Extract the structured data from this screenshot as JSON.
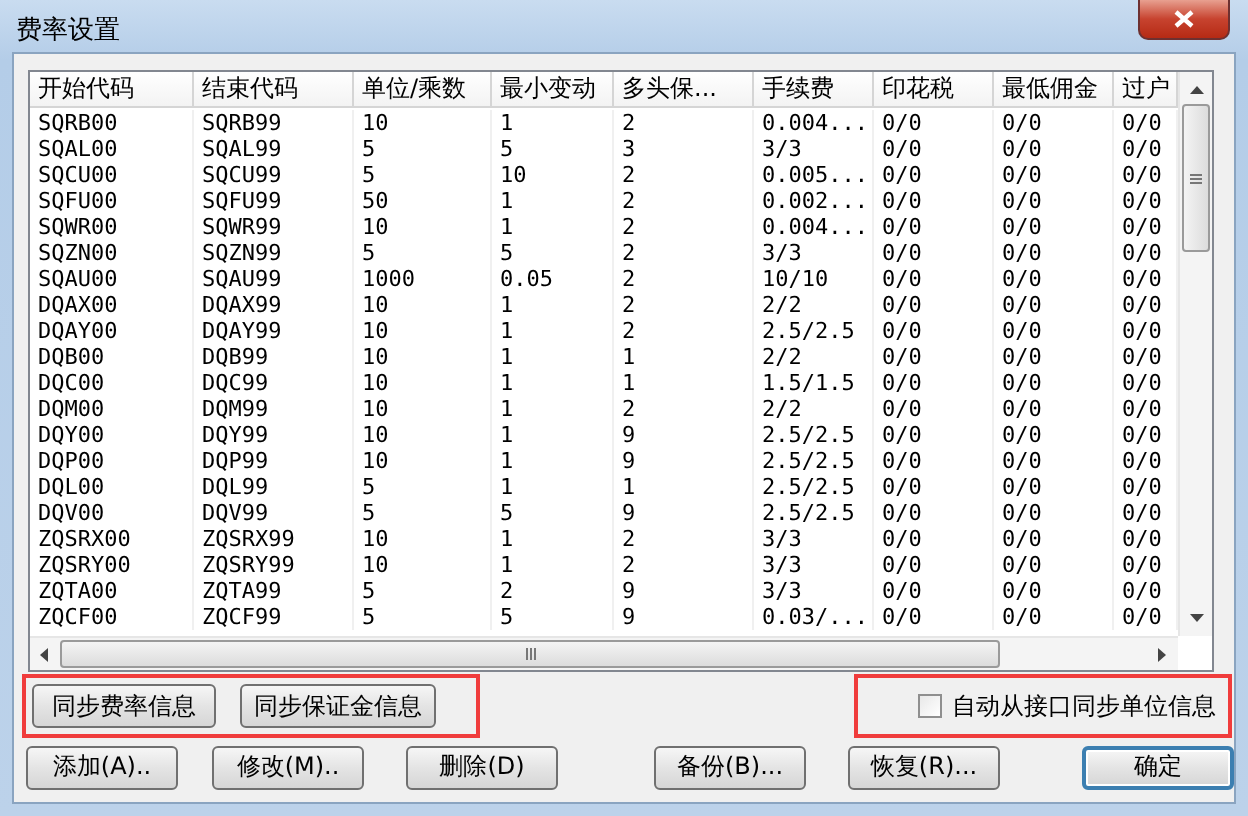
{
  "window": {
    "title": "费率设置"
  },
  "table": {
    "columns": [
      "开始代码",
      "结束代码",
      "单位/乘数",
      "最小变动",
      "多头保...",
      "手续费",
      "印花税",
      "最低佣金",
      "过户"
    ],
    "rows": [
      [
        "SQRB00",
        "SQRB99",
        "10",
        "1",
        "2",
        "0.004...",
        "0/0",
        "0/0",
        "0/0"
      ],
      [
        "SQAL00",
        "SQAL99",
        "5",
        "5",
        "3",
        "3/3",
        "0/0",
        "0/0",
        "0/0"
      ],
      [
        "SQCU00",
        "SQCU99",
        "5",
        "10",
        "2",
        "0.005...",
        "0/0",
        "0/0",
        "0/0"
      ],
      [
        "SQFU00",
        "SQFU99",
        "50",
        "1",
        "2",
        "0.002...",
        "0/0",
        "0/0",
        "0/0"
      ],
      [
        "SQWR00",
        "SQWR99",
        "10",
        "1",
        "2",
        "0.004...",
        "0/0",
        "0/0",
        "0/0"
      ],
      [
        "SQZN00",
        "SQZN99",
        "5",
        "5",
        "2",
        "3/3",
        "0/0",
        "0/0",
        "0/0"
      ],
      [
        "SQAU00",
        "SQAU99",
        "1000",
        "0.05",
        "2",
        "10/10",
        "0/0",
        "0/0",
        "0/0"
      ],
      [
        "DQAX00",
        "DQAX99",
        "10",
        "1",
        "2",
        "2/2",
        "0/0",
        "0/0",
        "0/0"
      ],
      [
        "DQAY00",
        "DQAY99",
        "10",
        "1",
        "2",
        "2.5/2.5",
        "0/0",
        "0/0",
        "0/0"
      ],
      [
        "DQB00",
        "DQB99",
        "10",
        "1",
        "1",
        "2/2",
        "0/0",
        "0/0",
        "0/0"
      ],
      [
        "DQC00",
        "DQC99",
        "10",
        "1",
        "1",
        "1.5/1.5",
        "0/0",
        "0/0",
        "0/0"
      ],
      [
        "DQM00",
        "DQM99",
        "10",
        "1",
        "2",
        "2/2",
        "0/0",
        "0/0",
        "0/0"
      ],
      [
        "DQY00",
        "DQY99",
        "10",
        "1",
        "9",
        "2.5/2.5",
        "0/0",
        "0/0",
        "0/0"
      ],
      [
        "DQP00",
        "DQP99",
        "10",
        "1",
        "9",
        "2.5/2.5",
        "0/0",
        "0/0",
        "0/0"
      ],
      [
        "DQL00",
        "DQL99",
        "5",
        "1",
        "1",
        "2.5/2.5",
        "0/0",
        "0/0",
        "0/0"
      ],
      [
        "DQV00",
        "DQV99",
        "5",
        "5",
        "9",
        "2.5/2.5",
        "0/0",
        "0/0",
        "0/0"
      ],
      [
        "ZQSRX00",
        "ZQSRX99",
        "10",
        "1",
        "2",
        "3/3",
        "0/0",
        "0/0",
        "0/0"
      ],
      [
        "ZQSRY00",
        "ZQSRY99",
        "10",
        "1",
        "2",
        "3/3",
        "0/0",
        "0/0",
        "0/0"
      ],
      [
        "ZQTA00",
        "ZQTA99",
        "5",
        "2",
        "9",
        "3/3",
        "0/0",
        "0/0",
        "0/0"
      ],
      [
        "ZQCF00",
        "ZQCF99",
        "5",
        "5",
        "9",
        "0.03/...",
        "0/0",
        "0/0",
        "0/0"
      ]
    ]
  },
  "sync_buttons": [
    "同步费率信息",
    "同步保证金信息"
  ],
  "auto_sync_checkbox": {
    "label": "自动从接口同步单位信息",
    "checked": false
  },
  "buttons": [
    {
      "label": "添加(A)..",
      "default": false
    },
    {
      "label": "修改(M)..",
      "default": false
    },
    {
      "label": "删除(D)",
      "default": false
    },
    {
      "label": "备份(B)...",
      "default": false
    },
    {
      "label": "恢复(R)...",
      "default": false
    },
    {
      "label": "确定",
      "default": true
    }
  ]
}
